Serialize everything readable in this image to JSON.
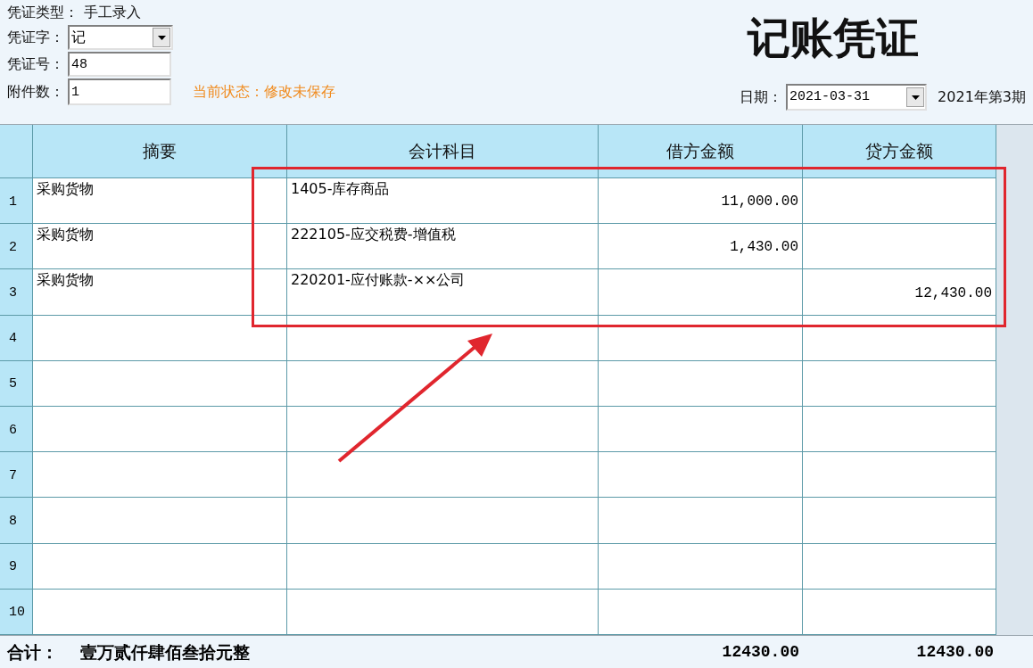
{
  "header": {
    "voucher_type_label": "凭证类型：",
    "voucher_type": "手工录入",
    "voucher_word_label": "凭证字：",
    "voucher_word": "记",
    "voucher_no_label": "凭证号：",
    "voucher_no": "48",
    "attachments_label": "附件数：",
    "attachments": "1",
    "status": "当前状态：修改未保存",
    "title": "记账凭证",
    "date_label": "日期：",
    "date": "2021-03-31",
    "period": "2021年第3期"
  },
  "table": {
    "columns": [
      "摘要",
      "会计科目",
      "借方金额",
      "贷方金额"
    ],
    "rows": [
      {
        "number": "1",
        "summary": "采购货物",
        "account": "1405-库存商品",
        "debit": "11,000.00"
      },
      {
        "number": "2",
        "summary": "采购货物",
        "account": "222105-应交税费-增值税",
        "debit": "1,430.00"
      },
      {
        "number": "3",
        "summary": "采购货物",
        "account": "220201-应付账款-××公司",
        "credit": "12,430.00"
      },
      {
        "number": "4"
      },
      {
        "number": "5"
      },
      {
        "number": "6"
      },
      {
        "number": "7"
      },
      {
        "number": "8"
      },
      {
        "number": "9"
      },
      {
        "number": "10"
      }
    ]
  },
  "footer": {
    "label": "合计：",
    "amount_words": "壹万贰仟肆佰叁拾元整",
    "debit_total": "12430.00",
    "credit_total": "12430.00"
  }
}
